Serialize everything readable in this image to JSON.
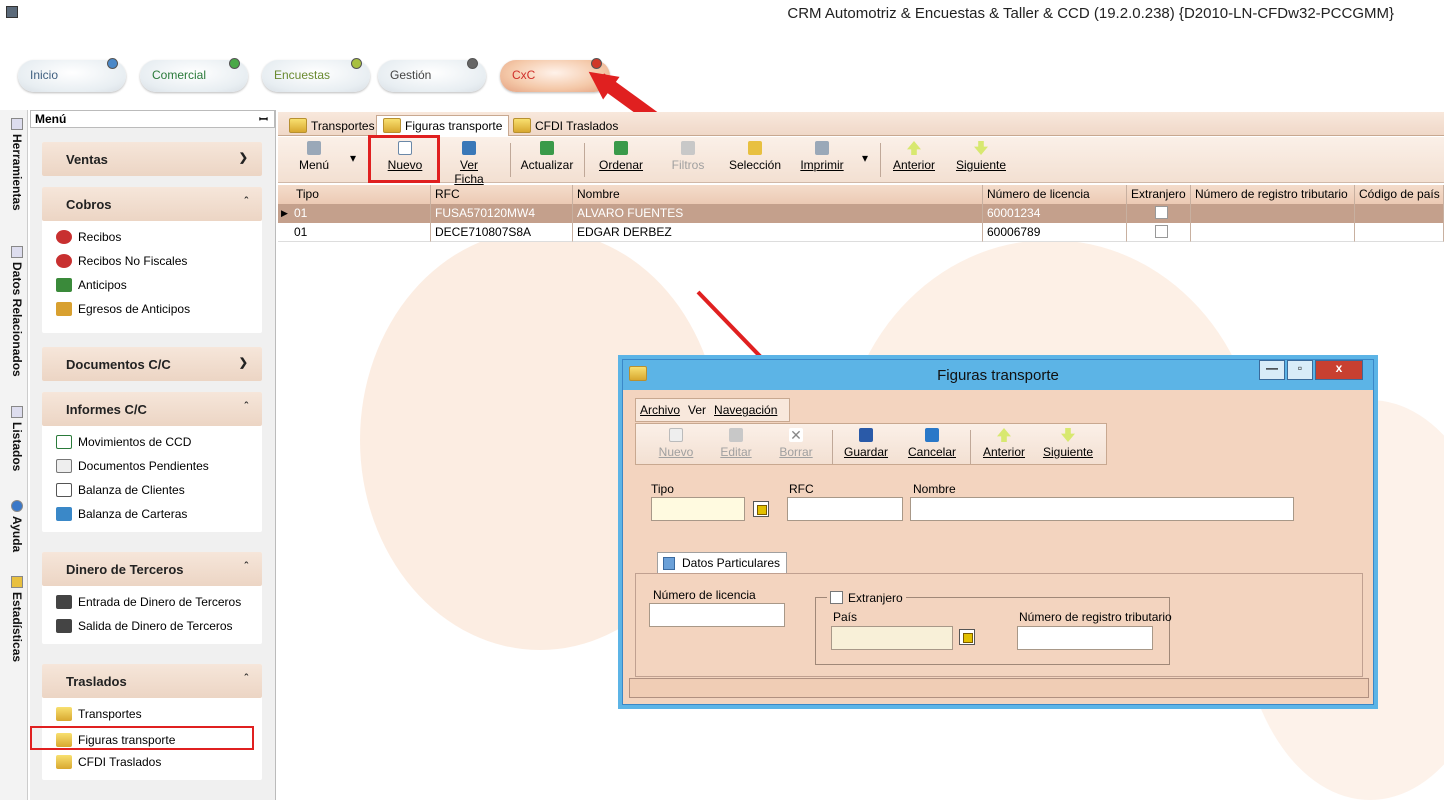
{
  "window": {
    "title": "CRM Automotriz & Encuestas & Taller & CCD (19.2.0.238) {D2010-LN-CFDw32-PCCGMM}"
  },
  "modules": [
    {
      "label": "Inicio"
    },
    {
      "label": "Comercial"
    },
    {
      "label": "Encuestas"
    },
    {
      "label": "Gestión"
    },
    {
      "label": "CxC"
    }
  ],
  "side_tabs": [
    "Herramientas",
    "Datos Relacionados",
    "Listados",
    "Ayuda",
    "Estadísticas"
  ],
  "menu": {
    "title": "Menú",
    "pin": "📌",
    "groups": [
      {
        "label": "Ventas",
        "chev": "⌄",
        "items": []
      },
      {
        "label": "Cobros",
        "chev": "⌃",
        "items": [
          "Recibos",
          "Recibos No Fiscales",
          "Anticipos",
          "Egresos de Anticipos"
        ]
      },
      {
        "label": "Documentos C/C",
        "chev": "⌄",
        "items": []
      },
      {
        "label": "Informes C/C",
        "chev": "⌃",
        "items": [
          "Movimientos de CCD",
          "Documentos Pendientes",
          "Balanza de Clientes",
          "Balanza de Carteras"
        ]
      },
      {
        "label": "Dinero de Terceros",
        "chev": "⌃",
        "items": [
          "Entrada de Dinero de Terceros",
          "Salida de Dinero de Terceros"
        ]
      },
      {
        "label": "Traslados",
        "chev": "⌃",
        "items": [
          "Transportes",
          "Figuras transporte",
          "CFDI Traslados"
        ]
      }
    ]
  },
  "tabs": [
    "Transportes",
    "Figuras transporte",
    "CFDI Traslados"
  ],
  "toolbar": {
    "menu": "Menú",
    "nuevo": "Nuevo",
    "ver_ficha": "Ver Ficha",
    "actualizar": "Actualizar",
    "ordenar": "Ordenar",
    "filtros": "Filtros",
    "seleccion": "Selección",
    "imprimir": "Imprimir",
    "anterior": "Anterior",
    "siguiente": "Siguiente"
  },
  "grid": {
    "columns": [
      "Tipo",
      "RFC",
      "Nombre",
      "Número de licencia",
      "Extranjero",
      "Número de registro tributario",
      "Código de país"
    ],
    "rows": [
      {
        "tipo": "01",
        "rfc": "FUSA570120MW4",
        "nombre": "ALVARO FUENTES",
        "licencia": "60001234"
      },
      {
        "tipo": "01",
        "rfc": "DECE710807S8A",
        "nombre": "EDGAR DERBEZ",
        "licencia": "60006789"
      }
    ]
  },
  "dialog": {
    "title": "Figuras transporte",
    "menu": [
      "Archivo",
      "Ver",
      "Navegación"
    ],
    "toolbar": {
      "nuevo": "Nuevo",
      "editar": "Editar",
      "borrar": "Borrar",
      "guardar": "Guardar",
      "cancelar": "Cancelar",
      "anterior": "Anterior",
      "siguiente": "Siguiente"
    },
    "labels": {
      "tipo": "Tipo",
      "rfc": "RFC",
      "nombre": "Nombre",
      "tab": "Datos Particulares",
      "licencia": "Número de licencia",
      "extranjero": "Extranjero",
      "pais": "País",
      "registro": "Número de registro tributario"
    },
    "controls": {
      "minimize": "—",
      "maximize": "▫",
      "close": "x"
    }
  },
  "colors": {
    "highlight": "#e02020",
    "accent": "#f3d4bf",
    "dialog_border": "#5cb4e6"
  }
}
